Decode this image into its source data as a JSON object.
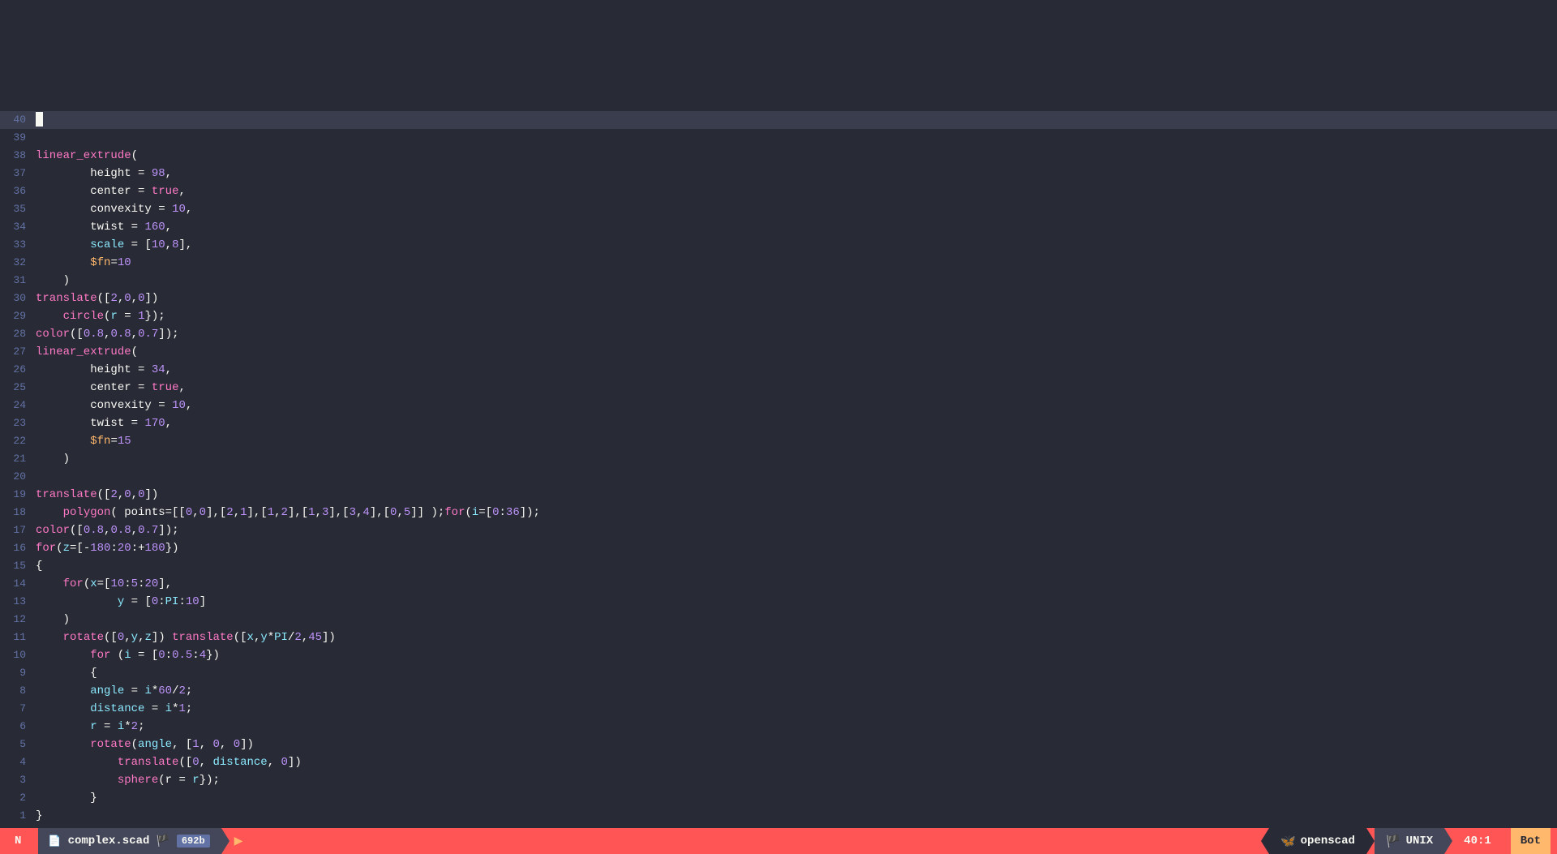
{
  "editor": {
    "title": "complex.scad",
    "filesize": "692b",
    "mode": "N",
    "position": "40:1",
    "scroll_indicator": "Bot",
    "filetype": "openscad",
    "encoding": "UNIX"
  },
  "lines": [
    {
      "num": 1,
      "content": [
        {
          "t": "punc",
          "v": "}"
        }
      ]
    },
    {
      "num": 2,
      "content": [
        {
          "t": "punc",
          "v": "        }"
        }
      ]
    },
    {
      "num": 3,
      "content": [
        {
          "t": "punc",
          "v": "            "
        },
        {
          "t": "fn",
          "v": "sphere"
        },
        {
          "t": "punc",
          "v": "("
        },
        {
          "t": "prop",
          "v": "r"
        },
        {
          "t": "punc",
          "v": " = "
        },
        {
          "t": "var",
          "v": "r"
        },
        {
          "t": "punc",
          "v": "});"
        }
      ]
    },
    {
      "num": 4,
      "content": [
        {
          "t": "punc",
          "v": "            "
        },
        {
          "t": "fn",
          "v": "translate"
        },
        {
          "t": "punc",
          "v": "(["
        },
        {
          "t": "num",
          "v": "0"
        },
        {
          "t": "punc",
          "v": ", "
        },
        {
          "t": "var",
          "v": "distance"
        },
        {
          "t": "punc",
          "v": ", "
        },
        {
          "t": "num",
          "v": "0"
        },
        {
          "t": "punc",
          "v": "])"
        }
      ]
    },
    {
      "num": 5,
      "content": [
        {
          "t": "punc",
          "v": "        "
        },
        {
          "t": "fn",
          "v": "rotate"
        },
        {
          "t": "punc",
          "v": "("
        },
        {
          "t": "var",
          "v": "angle"
        },
        {
          "t": "punc",
          "v": ", ["
        },
        {
          "t": "num",
          "v": "1"
        },
        {
          "t": "punc",
          "v": ", "
        },
        {
          "t": "num",
          "v": "0"
        },
        {
          "t": "punc",
          "v": ", "
        },
        {
          "t": "num",
          "v": "0"
        },
        {
          "t": "punc",
          "v": "])"
        }
      ]
    },
    {
      "num": 6,
      "content": [
        {
          "t": "punc",
          "v": "        "
        },
        {
          "t": "var",
          "v": "r"
        },
        {
          "t": "punc",
          "v": " = "
        },
        {
          "t": "var",
          "v": "i"
        },
        {
          "t": "punc",
          "v": "*"
        },
        {
          "t": "num",
          "v": "2"
        },
        {
          "t": "punc",
          "v": ";"
        }
      ]
    },
    {
      "num": 7,
      "content": [
        {
          "t": "punc",
          "v": "        "
        },
        {
          "t": "var",
          "v": "distance"
        },
        {
          "t": "punc",
          "v": " = "
        },
        {
          "t": "var",
          "v": "i"
        },
        {
          "t": "punc",
          "v": "*"
        },
        {
          "t": "num",
          "v": "1"
        },
        {
          "t": "punc",
          "v": ";"
        }
      ]
    },
    {
      "num": 8,
      "content": [
        {
          "t": "punc",
          "v": "        "
        },
        {
          "t": "var",
          "v": "angle"
        },
        {
          "t": "punc",
          "v": " = "
        },
        {
          "t": "var",
          "v": "i"
        },
        {
          "t": "punc",
          "v": "*"
        },
        {
          "t": "num",
          "v": "60"
        },
        {
          "t": "punc",
          "v": "/"
        },
        {
          "t": "num",
          "v": "2"
        },
        {
          "t": "punc",
          "v": ";"
        }
      ]
    },
    {
      "num": 9,
      "content": [
        {
          "t": "punc",
          "v": "        {"
        }
      ]
    },
    {
      "num": 10,
      "content": [
        {
          "t": "punc",
          "v": "        "
        },
        {
          "t": "kw",
          "v": "for"
        },
        {
          "t": "punc",
          "v": " ("
        },
        {
          "t": "var",
          "v": "i"
        },
        {
          "t": "punc",
          "v": " = ["
        },
        {
          "t": "num",
          "v": "0"
        },
        {
          "t": "punc",
          "v": ":"
        },
        {
          "t": "num",
          "v": "0.5"
        },
        {
          "t": "punc",
          "v": ":"
        },
        {
          "t": "num",
          "v": "4"
        },
        {
          "t": "punc",
          "v": "})"
        }
      ]
    },
    {
      "num": 11,
      "content": [
        {
          "t": "punc",
          "v": "    "
        },
        {
          "t": "fn",
          "v": "rotate"
        },
        {
          "t": "punc",
          "v": "(["
        },
        {
          "t": "num",
          "v": "0"
        },
        {
          "t": "punc",
          "v": ","
        },
        {
          "t": "var",
          "v": "y"
        },
        {
          "t": "punc",
          "v": ","
        },
        {
          "t": "var",
          "v": "z"
        },
        {
          "t": "punc",
          "v": "]) "
        },
        {
          "t": "fn",
          "v": "translate"
        },
        {
          "t": "punc",
          "v": "(["
        },
        {
          "t": "var",
          "v": "x"
        },
        {
          "t": "punc",
          "v": ","
        },
        {
          "t": "var",
          "v": "y"
        },
        {
          "t": "punc",
          "v": "*"
        },
        {
          "t": "var",
          "v": "PI"
        },
        {
          "t": "punc",
          "v": "/"
        },
        {
          "t": "num",
          "v": "2"
        },
        {
          "t": "punc",
          "v": ","
        },
        {
          "t": "num",
          "v": "45"
        },
        {
          "t": "punc",
          "v": "])"
        }
      ]
    },
    {
      "num": 12,
      "content": [
        {
          "t": "punc",
          "v": "    )"
        }
      ]
    },
    {
      "num": 13,
      "content": [
        {
          "t": "punc",
          "v": "            "
        },
        {
          "t": "var",
          "v": "y"
        },
        {
          "t": "punc",
          "v": " = ["
        },
        {
          "t": "num",
          "v": "0"
        },
        {
          "t": "punc",
          "v": ":"
        },
        {
          "t": "var",
          "v": "PI"
        },
        {
          "t": "punc",
          "v": ":"
        },
        {
          "t": "num",
          "v": "10"
        },
        {
          "t": "punc",
          "v": "]"
        }
      ]
    },
    {
      "num": 14,
      "content": [
        {
          "t": "punc",
          "v": "    "
        },
        {
          "t": "kw",
          "v": "for"
        },
        {
          "t": "punc",
          "v": "("
        },
        {
          "t": "var",
          "v": "x"
        },
        {
          "t": "punc",
          "v": "=["
        },
        {
          "t": "num",
          "v": "10"
        },
        {
          "t": "punc",
          "v": ":"
        },
        {
          "t": "num",
          "v": "5"
        },
        {
          "t": "punc",
          "v": ":"
        },
        {
          "t": "num",
          "v": "20"
        },
        {
          "t": "punc",
          "v": "],"
        }
      ]
    },
    {
      "num": 15,
      "content": [
        {
          "t": "punc",
          "v": "{"
        }
      ]
    },
    {
      "num": 16,
      "content": [
        {
          "t": "kw",
          "v": "for"
        },
        {
          "t": "punc",
          "v": "("
        },
        {
          "t": "var",
          "v": "z"
        },
        {
          "t": "punc",
          "v": "=[-"
        },
        {
          "t": "num",
          "v": "180"
        },
        {
          "t": "punc",
          "v": ":"
        },
        {
          "t": "num",
          "v": "20"
        },
        {
          "t": "punc",
          "v": ":+"
        },
        {
          "t": "num",
          "v": "180"
        },
        {
          "t": "punc",
          "v": "})"
        }
      ]
    },
    {
      "num": 17,
      "content": [
        {
          "t": "fn",
          "v": "color"
        },
        {
          "t": "punc",
          "v": "(["
        },
        {
          "t": "num",
          "v": "0.8"
        },
        {
          "t": "punc",
          "v": ","
        },
        {
          "t": "num",
          "v": "0.8"
        },
        {
          "t": "punc",
          "v": ","
        },
        {
          "t": "num",
          "v": "0.7"
        },
        {
          "t": "punc",
          "v": "]);"
        }
      ]
    },
    {
      "num": 18,
      "content": [
        {
          "t": "punc",
          "v": "    "
        },
        {
          "t": "fn",
          "v": "polygon"
        },
        {
          "t": "punc",
          "v": "( points=[["
        },
        {
          "t": "num",
          "v": "0"
        },
        {
          "t": "punc",
          "v": ","
        },
        {
          "t": "num",
          "v": "0"
        },
        {
          "t": "punc",
          "v": "],["
        },
        {
          "t": "num",
          "v": "2"
        },
        {
          "t": "punc",
          "v": ","
        },
        {
          "t": "num",
          "v": "1"
        },
        {
          "t": "punc",
          "v": "],["
        },
        {
          "t": "num",
          "v": "1"
        },
        {
          "t": "punc",
          "v": ","
        },
        {
          "t": "num",
          "v": "2"
        },
        {
          "t": "punc",
          "v": "],["
        },
        {
          "t": "num",
          "v": "1"
        },
        {
          "t": "punc",
          "v": ","
        },
        {
          "t": "num",
          "v": "3"
        },
        {
          "t": "punc",
          "v": "],["
        },
        {
          "t": "num",
          "v": "3"
        },
        {
          "t": "punc",
          "v": ","
        },
        {
          "t": "num",
          "v": "4"
        },
        {
          "t": "punc",
          "v": "],["
        },
        {
          "t": "num",
          "v": "0"
        },
        {
          "t": "punc",
          "v": ","
        },
        {
          "t": "num",
          "v": "5"
        },
        {
          "t": "punc",
          "v": "]] );"
        },
        {
          "t": "kw",
          "v": "for"
        },
        {
          "t": "punc",
          "v": "("
        },
        {
          "t": "var",
          "v": "i"
        },
        {
          "t": "punc",
          "v": "=["
        },
        {
          "t": "num",
          "v": "0"
        },
        {
          "t": "punc",
          "v": ":"
        },
        {
          "t": "num",
          "v": "36"
        },
        {
          "t": "punc",
          "v": "]);"
        }
      ]
    },
    {
      "num": 19,
      "content": [
        {
          "t": "fn",
          "v": "translate"
        },
        {
          "t": "punc",
          "v": "(["
        },
        {
          "t": "num",
          "v": "2"
        },
        {
          "t": "punc",
          "v": ","
        },
        {
          "t": "num",
          "v": "0"
        },
        {
          "t": "punc",
          "v": ","
        },
        {
          "t": "num",
          "v": "0"
        },
        {
          "t": "punc",
          "v": "])"
        }
      ]
    },
    {
      "num": 20,
      "content": []
    },
    {
      "num": 21,
      "content": [
        {
          "t": "punc",
          "v": "    )"
        }
      ]
    },
    {
      "num": 22,
      "content": [
        {
          "t": "punc",
          "v": "        "
        },
        {
          "t": "special",
          "v": "$fn"
        },
        {
          "t": "punc",
          "v": "="
        },
        {
          "t": "num",
          "v": "15"
        }
      ]
    },
    {
      "num": 23,
      "content": [
        {
          "t": "punc",
          "v": "        "
        },
        {
          "t": "prop",
          "v": "twist"
        },
        {
          "t": "punc",
          "v": " = "
        },
        {
          "t": "num",
          "v": "170"
        },
        {
          "t": "punc",
          "v": ","
        }
      ]
    },
    {
      "num": 24,
      "content": [
        {
          "t": "punc",
          "v": "        "
        },
        {
          "t": "prop",
          "v": "convexity"
        },
        {
          "t": "punc",
          "v": " = "
        },
        {
          "t": "num",
          "v": "10"
        },
        {
          "t": "punc",
          "v": ","
        }
      ]
    },
    {
      "num": 25,
      "content": [
        {
          "t": "punc",
          "v": "        "
        },
        {
          "t": "prop",
          "v": "center"
        },
        {
          "t": "punc",
          "v": " = "
        },
        {
          "t": "bool",
          "v": "true"
        },
        {
          "t": "punc",
          "v": ","
        }
      ]
    },
    {
      "num": 26,
      "content": [
        {
          "t": "punc",
          "v": "        "
        },
        {
          "t": "prop",
          "v": "height"
        },
        {
          "t": "punc",
          "v": " = "
        },
        {
          "t": "num",
          "v": "34"
        },
        {
          "t": "punc",
          "v": ","
        }
      ]
    },
    {
      "num": 27,
      "content": [
        {
          "t": "fn",
          "v": "linear_extrude"
        },
        {
          "t": "punc",
          "v": "("
        }
      ]
    },
    {
      "num": 28,
      "content": [
        {
          "t": "fn",
          "v": "color"
        },
        {
          "t": "punc",
          "v": "(["
        },
        {
          "t": "num",
          "v": "0.8"
        },
        {
          "t": "punc",
          "v": ","
        },
        {
          "t": "num",
          "v": "0.8"
        },
        {
          "t": "punc",
          "v": ","
        },
        {
          "t": "num",
          "v": "0.7"
        },
        {
          "t": "punc",
          "v": "]);"
        }
      ]
    },
    {
      "num": 29,
      "content": [
        {
          "t": "punc",
          "v": "    "
        },
        {
          "t": "fn",
          "v": "circle"
        },
        {
          "t": "punc",
          "v": "("
        },
        {
          "t": "var",
          "v": "r"
        },
        {
          "t": "punc",
          "v": " = "
        },
        {
          "t": "num",
          "v": "1"
        },
        {
          "t": "punc",
          "v": "});"
        }
      ]
    },
    {
      "num": 30,
      "content": [
        {
          "t": "fn",
          "v": "translate"
        },
        {
          "t": "punc",
          "v": "(["
        },
        {
          "t": "num",
          "v": "2"
        },
        {
          "t": "punc",
          "v": ","
        },
        {
          "t": "num",
          "v": "0"
        },
        {
          "t": "punc",
          "v": ","
        },
        {
          "t": "num",
          "v": "0"
        },
        {
          "t": "punc",
          "v": "])"
        }
      ]
    },
    {
      "num": 31,
      "content": [
        {
          "t": "punc",
          "v": "    )"
        }
      ]
    },
    {
      "num": 32,
      "content": [
        {
          "t": "punc",
          "v": "        "
        },
        {
          "t": "special",
          "v": "$fn"
        },
        {
          "t": "punc",
          "v": "="
        },
        {
          "t": "num",
          "v": "10"
        }
      ]
    },
    {
      "num": 33,
      "content": [
        {
          "t": "punc",
          "v": "        "
        },
        {
          "t": "var",
          "v": "scale"
        },
        {
          "t": "punc",
          "v": " = ["
        },
        {
          "t": "num",
          "v": "10"
        },
        {
          "t": "punc",
          "v": ","
        },
        {
          "t": "num",
          "v": "8"
        },
        {
          "t": "punc",
          "v": "],"
        }
      ]
    },
    {
      "num": 34,
      "content": [
        {
          "t": "punc",
          "v": "        "
        },
        {
          "t": "prop",
          "v": "twist"
        },
        {
          "t": "punc",
          "v": " = "
        },
        {
          "t": "num",
          "v": "160"
        },
        {
          "t": "punc",
          "v": ","
        }
      ]
    },
    {
      "num": 35,
      "content": [
        {
          "t": "punc",
          "v": "        "
        },
        {
          "t": "prop",
          "v": "convexity"
        },
        {
          "t": "punc",
          "v": " = "
        },
        {
          "t": "num",
          "v": "10"
        },
        {
          "t": "punc",
          "v": ","
        }
      ]
    },
    {
      "num": 36,
      "content": [
        {
          "t": "punc",
          "v": "        "
        },
        {
          "t": "prop",
          "v": "center"
        },
        {
          "t": "punc",
          "v": " = "
        },
        {
          "t": "bool",
          "v": "true"
        },
        {
          "t": "punc",
          "v": ","
        }
      ]
    },
    {
      "num": 37,
      "content": [
        {
          "t": "punc",
          "v": "        "
        },
        {
          "t": "prop",
          "v": "height"
        },
        {
          "t": "punc",
          "v": " = "
        },
        {
          "t": "num",
          "v": "98"
        },
        {
          "t": "punc",
          "v": ","
        }
      ]
    },
    {
      "num": 38,
      "content": [
        {
          "t": "fn",
          "v": "linear_extrude"
        },
        {
          "t": "punc",
          "v": "("
        }
      ]
    },
    {
      "num": 39,
      "content": []
    },
    {
      "num": 40,
      "content": [
        {
          "t": "cursor",
          "v": ""
        }
      ],
      "cursor": true
    }
  ],
  "statusbar": {
    "mode": "N",
    "filename": "complex.scad",
    "filesize": "692b",
    "filetype_icon": "🦋",
    "filetype": "openscad",
    "encoding_flag": "🏴",
    "encoding": "UNIX",
    "position": "40:1",
    "bot": "Bot"
  }
}
